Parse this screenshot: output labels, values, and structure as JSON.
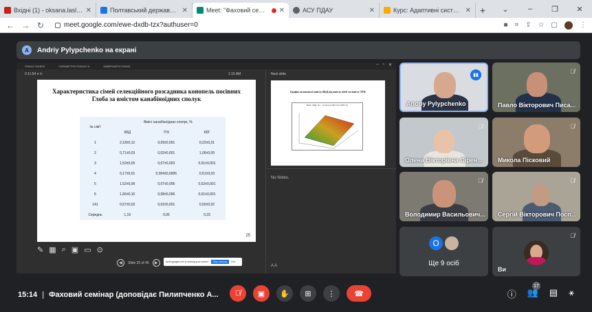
{
  "browser": {
    "tabs": [
      {
        "label": "Вхідні (1) - oksana.laslo@pd",
        "color": "#c5221f",
        "active": false
      },
      {
        "label": "Полтавський державний аг",
        "color": "#1a73e8",
        "active": false
      },
      {
        "label": "Meet: \"Фаховий семінар",
        "color": "#00897b",
        "active": true
      },
      {
        "label": "АСУ ПДАУ",
        "color": "#5f6368",
        "active": false
      },
      {
        "label": "Курс: Адаптивні системи зе",
        "color": "#f9ab00",
        "active": false
      }
    ],
    "new_tab": "+",
    "url": "meet.google.com/ewe-dxdb-tzx?authuser=0"
  },
  "meet": {
    "presenter": {
      "initial": "A",
      "label": "Andriy Pylypchenko на екрані"
    },
    "screen": {
      "toolbar_items": [
        "ПОКАЗ ПАНЕЛІ",
        "ПАРАМЕТРИ ПОКАЗУ ▾",
        "ЗАВЕРШИТИ ПОКАЗ"
      ],
      "timer": "0:11:54  ⏸  ↻",
      "clock": "1:15 AM",
      "slide": {
        "title": "Характеристика сімей селекційного розсадника конопель посівних Глоба за вмістом канабіноїдних сполук",
        "header_row_label": "№ сім'ї",
        "group_header": "Вміст канабіноїдних сполук, %",
        "columns": [
          "КБД",
          "ТГК",
          "КБГ"
        ],
        "rows": [
          {
            "id": "1",
            "kbd": "2,18±0,12",
            "tgk": "0,09±0,001",
            "kbg": "0,22±0,01"
          },
          {
            "id": "2",
            "kbd": "0,71±0,03",
            "tgk": "0,02±0,001",
            "kbg": "1,06±0,09"
          },
          {
            "id": "3",
            "kbd": "1,53±0,05",
            "tgk": "0,07±0,003",
            "kbg": "0,01±0,001"
          },
          {
            "id": "4",
            "kbd": "0,17±0,01",
            "tgk": "0,004±0,0006",
            "kbg": "0,51±0,03"
          },
          {
            "id": "5",
            "kbd": "1,52±0,09",
            "tgk": "0,07±0,006",
            "kbg": "0,02±0,001"
          },
          {
            "id": "6",
            "kbd": "1,66±0,10",
            "tgk": "0,08±0,006",
            "kbg": "0,01±0,001"
          },
          {
            "id": "141",
            "kbd": "0,57±0,03",
            "tgk": "0,02±0,001",
            "kbg": "0,50±0,02"
          },
          {
            "id": "Середнє",
            "kbd": "1,19",
            "tgk": "0,05",
            "kbg": "0,33"
          }
        ],
        "page": "25"
      },
      "slide_counter": "Slide 25 of 45",
      "notification": {
        "text": "meet.google.com is sharing your screen.",
        "stop": "Stop sharing",
        "hide": "Hide"
      },
      "next_label": "Next slide",
      "next_title": "Графік залежності вмісту КБД від вмісту кбгб та вмісту ТГК",
      "plot_title": "Вміст КБД, %= - sin(1/x)+0,99x^2+0,265x^2y",
      "notes": "No Notes.",
      "notes_controls": "A  A"
    },
    "participants": [
      {
        "name": "Andriy Pylypchenko",
        "speaking": true
      },
      {
        "name": "Павло Вікторович Писа...",
        "speaking": false
      },
      {
        "name": "Олена Вікторівна Сірен...",
        "speaking": false
      },
      {
        "name": "Микола Пісковий",
        "speaking": false
      },
      {
        "name": "Володимир Васильович...",
        "speaking": false
      },
      {
        "name": "Сергій Вікторович Посп...",
        "speaking": false
      }
    ],
    "others": {
      "initial": "O",
      "label": "Ще 9 осіб"
    },
    "self": {
      "name": "Ви"
    },
    "bottom": {
      "time": "15:14",
      "separator": "|",
      "meeting_title": "Фаховий семінар (доповідає Пилипченко А...",
      "participants_count": "17"
    }
  }
}
